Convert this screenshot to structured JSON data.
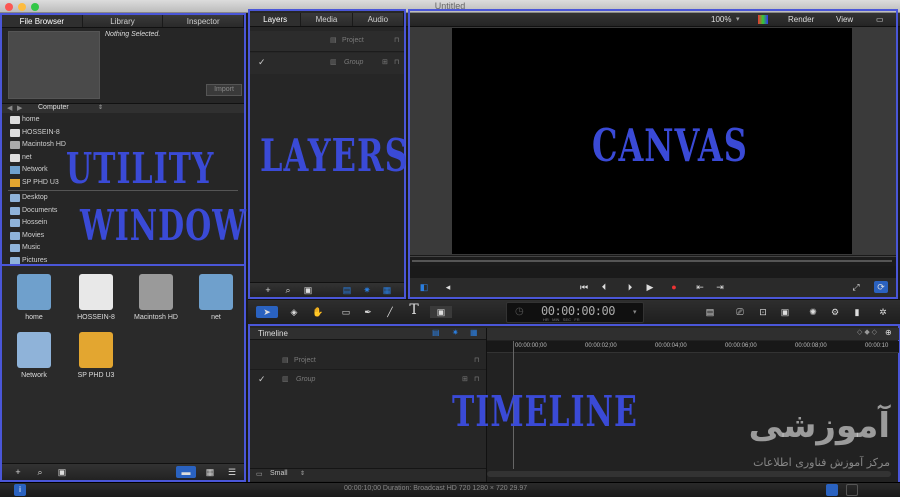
{
  "window": {
    "title": "Untitled"
  },
  "browser": {
    "tabs": [
      "File Browser",
      "Library",
      "Inspector"
    ],
    "nothing_selected": "Nothing Selected.",
    "import_label": "Import",
    "location": "Computer",
    "devices": [
      "home",
      "HOSSEIN-8",
      "Macintosh HD",
      "net",
      "Network",
      "SP PHD U3"
    ],
    "places": [
      "Desktop",
      "Documents",
      "Hossein",
      "Movies",
      "Music",
      "Pictures"
    ],
    "grid_items": [
      "home",
      "HOSSEIN-8",
      "Macintosh HD",
      "net",
      "Network",
      "SP PHD U3"
    ]
  },
  "layers": {
    "tabs": [
      "Layers",
      "Media",
      "Audio"
    ],
    "rows": [
      {
        "check": "",
        "name": "Project"
      },
      {
        "check": "✓",
        "name": "Group"
      }
    ]
  },
  "canvas": {
    "zoom": "100%",
    "render": "Render",
    "view": "View"
  },
  "toolbar": {
    "timecode": "00:00:00:00",
    "tc_units": "HR   MIN   SEC   FR"
  },
  "timeline": {
    "title": "Timeline",
    "rows": [
      {
        "check": "",
        "name": "Project"
      },
      {
        "check": "✓",
        "name": "Group"
      }
    ],
    "ruler": [
      "00:00:00;00",
      "00:00:02;00",
      "00:00:04;00",
      "00:00:06;00",
      "00:00:08;00",
      "00:00:10"
    ],
    "size_label": "Small"
  },
  "status": {
    "text": "00:00:10;00 Duration: Broadcast HD 720 1280 × 720 29.97"
  },
  "annotations": {
    "utility1": "UTILITY",
    "utility2": "WINDOW",
    "layers": "LAYERS",
    "canvas": "CANVAS",
    "timeline": "TIMELINE"
  },
  "watermark": {
    "line1": "آموزشی",
    "line2": "مرکز آموزش فناوری اطلاعات"
  },
  "colors": {
    "annotation": "#3a4ad6",
    "frame": "#4a56d8",
    "accent_blue": "#2a7ee0"
  }
}
